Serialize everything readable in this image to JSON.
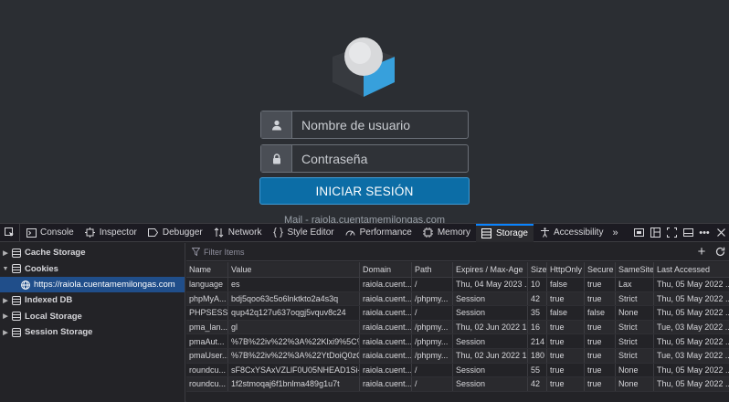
{
  "login": {
    "username_placeholder": "Nombre de usuario",
    "password_placeholder": "Contraseña",
    "submit_label": "INICIAR SESIÓN",
    "footer_text": "Mail - raiola.cuentamemilongas.com"
  },
  "devtools": {
    "tabs": [
      {
        "label": "Console",
        "icon": "console-icon"
      },
      {
        "label": "Inspector",
        "icon": "inspector-icon"
      },
      {
        "label": "Debugger",
        "icon": "debugger-icon"
      },
      {
        "label": "Network",
        "icon": "network-icon"
      },
      {
        "label": "Style Editor",
        "icon": "style-editor-icon"
      },
      {
        "label": "Performance",
        "icon": "performance-icon"
      },
      {
        "label": "Memory",
        "icon": "memory-icon"
      },
      {
        "label": "Storage",
        "icon": "storage-icon",
        "active": true
      },
      {
        "label": "Accessibility",
        "icon": "accessibility-icon"
      }
    ],
    "sidebar": {
      "cache_storage": "Cache Storage",
      "cookies": "Cookies",
      "cookie_origin": "https://raiola.cuentamemilongas.com",
      "indexed_db": "Indexed DB",
      "local_storage": "Local Storage",
      "session_storage": "Session Storage"
    },
    "filter_placeholder": "Filter Items",
    "columns": [
      "Name",
      "Value",
      "Domain",
      "Path",
      "Expires / Max-Age",
      "Size",
      "HttpOnly",
      "Secure",
      "SameSite",
      "Last Accessed"
    ],
    "rows": [
      [
        "language",
        "es",
        "raiola.cuent...",
        "/",
        "Thu, 04 May 2023 ...",
        "10",
        "false",
        "true",
        "Lax",
        "Thu, 05 May 2022 ..."
      ],
      [
        "phpMyA...",
        "bdj5qoo63c5o6lnktkto2a4s3q",
        "raiola.cuent...",
        "/phpmy...",
        "Session",
        "42",
        "true",
        "true",
        "Strict",
        "Thu, 05 May 2022 ..."
      ],
      [
        "PHPSESS...",
        "qup42q127u637oqgj5vquv8c24",
        "raiola.cuent...",
        "/",
        "Session",
        "35",
        "false",
        "false",
        "None",
        "Thu, 05 May 2022 ..."
      ],
      [
        "pma_lan...",
        "gl",
        "raiola.cuent...",
        "/phpmy...",
        "Thu, 02 Jun 2022 1...",
        "16",
        "true",
        "true",
        "Strict",
        "Tue, 03 May 2022 ..."
      ],
      [
        "pmaAut...",
        "%7B%22iv%22%3A%22Klxi9%5C%2...",
        "raiola.cuent...",
        "/phpmy...",
        "Session",
        "214",
        "true",
        "true",
        "Strict",
        "Thu, 05 May 2022 ..."
      ],
      [
        "pmaUser...",
        "%7B%22iv%22%3A%22YtDoiQ0zQ5...",
        "raiola.cuent...",
        "/phpmy...",
        "Thu, 02 Jun 2022 1...",
        "180",
        "true",
        "true",
        "Strict",
        "Tue, 03 May 2022 ..."
      ],
      [
        "roundcu...",
        "sF8CxYSAxVZLlF0U05NHEAD1Si-16...",
        "raiola.cuent...",
        "/",
        "Session",
        "55",
        "true",
        "true",
        "None",
        "Thu, 05 May 2022 ..."
      ],
      [
        "roundcu...",
        "1f2stmoqaj6f1bnlma489g1u7t",
        "raiola.cuent...",
        "/",
        "Session",
        "42",
        "true",
        "true",
        "None",
        "Thu, 05 May 2022 ..."
      ]
    ]
  },
  "colors": {
    "page_bg": "#2b2e33",
    "button_blue": "#0c6da6",
    "devtools_bg": "#232327",
    "selection_blue": "#204e8a",
    "active_tab_accent": "#0a84ff"
  }
}
